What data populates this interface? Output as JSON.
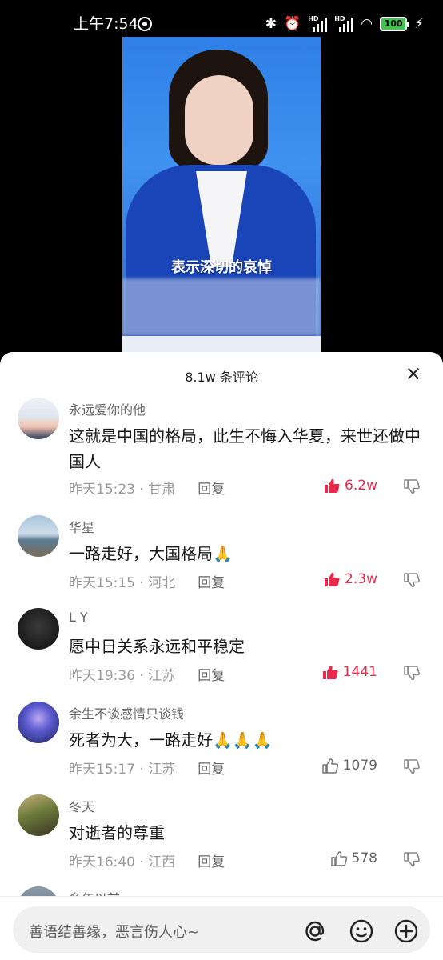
{
  "status": {
    "time": "上午7:54",
    "battery": "100",
    "hd1": "HD",
    "hd2": "HD"
  },
  "video": {
    "subtitle": "表示深切的哀悼"
  },
  "comments_panel": {
    "title": "8.1w 条评论",
    "comments": [
      {
        "user": "永远爱你的他",
        "text": "这就是中国的格局，此生不悔入华夏，来世还做中国人",
        "time": "昨天15:23 · 甘肃",
        "reply": "回复",
        "likes": "6.2w",
        "liked_style": "hot"
      },
      {
        "user": "华星",
        "text": "一路走好，大国格局🙏",
        "time": "昨天15:15 · 河北",
        "reply": "回复",
        "likes": "2.3w",
        "liked_style": "hot"
      },
      {
        "user": "L Y",
        "text": "愿中日关系永远和平稳定",
        "time": "昨天19:36 · 江苏",
        "reply": "回复",
        "likes": "1441",
        "liked_style": "hot"
      },
      {
        "user": "余生不谈感情只谈钱",
        "text": "死者为大，一路走好🙏🙏🙏",
        "time": "昨天15:17 · 江苏",
        "reply": "回复",
        "likes": "1079",
        "liked_style": "norm"
      },
      {
        "user": "冬天",
        "text": "对逝者的尊重",
        "time": "昨天16:40 · 江西",
        "reply": "回复",
        "likes": "578",
        "liked_style": "norm"
      },
      {
        "user": "多年以前",
        "text": "",
        "time": "",
        "reply": "",
        "likes": "",
        "liked_style": "norm"
      }
    ]
  },
  "input": {
    "placeholder": "善语结善缘，恶言伤人心~"
  },
  "icons": {
    "at": "at-icon",
    "emoji": "emoji-icon",
    "add": "add-icon"
  },
  "colors": {
    "hot_like": "#e8294b",
    "battery": "#3ec44a"
  }
}
